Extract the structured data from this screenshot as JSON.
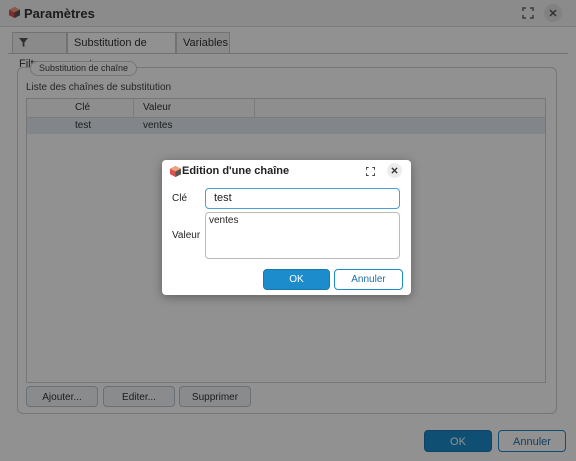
{
  "window": {
    "title": "Paramètres",
    "tabs": [
      {
        "label": "Filtres"
      },
      {
        "label": "Substitution de mots"
      },
      {
        "label": "Variables"
      }
    ],
    "active_tab": "Substitution de mots",
    "fieldset_legend": "Substitution de chaîne",
    "list_label": "Liste des chaînes de substitution",
    "grid": {
      "columns": [
        "Clé",
        "Valeur"
      ],
      "rows": [
        {
          "cle": "test",
          "valeur": "ventes"
        }
      ]
    },
    "actions": {
      "add": "Ajouter...",
      "edit": "Editer...",
      "delete": "Supprimer"
    },
    "footer": {
      "ok": "OK",
      "cancel": "Annuler"
    }
  },
  "dialog": {
    "title": "Edition d'une chaîne",
    "key_label": "Clé",
    "key_value": "test",
    "value_label": "Valeur",
    "value_value": "ventes",
    "ok": "OK",
    "cancel": "Annuler"
  },
  "colors": {
    "accent": "#1c8ccc",
    "overlay": "rgba(0,0,0,0.43)",
    "selected_row": "#e4ebf3"
  },
  "icons": {
    "app": "app-cube-icon",
    "filter": "filter-icon",
    "maximize": "maximize-icon",
    "close": "close-icon"
  }
}
